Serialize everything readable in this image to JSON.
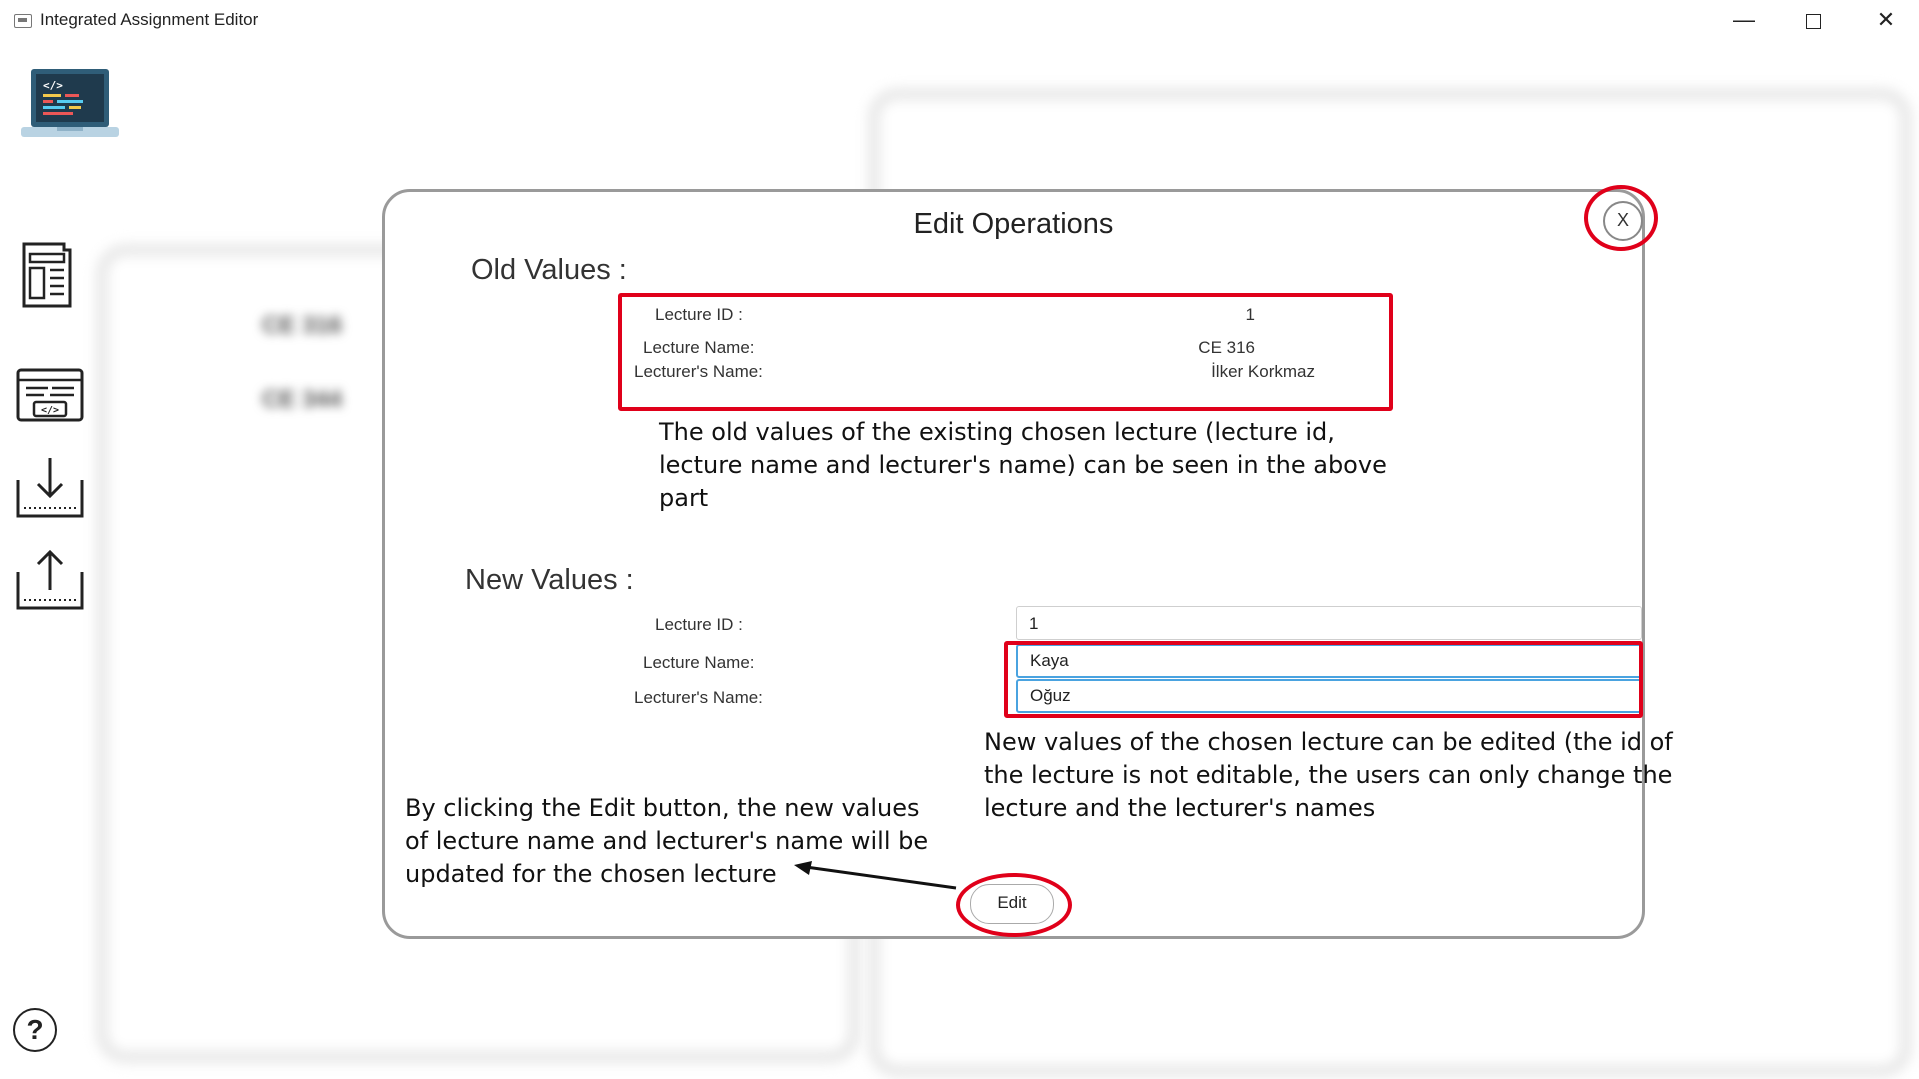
{
  "window": {
    "title": "Integrated Assignment Editor",
    "minimize_glyph": "—",
    "close_glyph": "✕"
  },
  "sidebar": {
    "icons": [
      "code-laptop-icon",
      "document-layout-icon",
      "code-window-icon",
      "download-tray-icon",
      "upload-tray-icon"
    ],
    "help_glyph": "?"
  },
  "background": {
    "left_items": [
      "CE 316",
      "CE 344"
    ]
  },
  "dialog": {
    "title": "Edit Operations",
    "close_label": "X",
    "old_values": {
      "heading": "Old Values :",
      "lecture_id_label": "Lecture ID :",
      "lecture_id_value": "1",
      "lecture_name_label": "Lecture Name:",
      "lecture_name_value": "CE 316",
      "lecturer_name_label": "Lecturer's Name:",
      "lecturer_name_value": "İlker Korkmaz"
    },
    "new_values": {
      "heading": "New Values :",
      "lecture_id_label": "Lecture ID :",
      "lecture_id_value": "1",
      "lecture_name_label": "Lecture Name:",
      "lecture_name_value": "Kaya",
      "lecturer_name_label": "Lecturer's Name:",
      "lecturer_name_value": "Oğuz"
    },
    "edit_label": "Edit"
  },
  "annotations": {
    "old_values_note": [
      "The old values of the existing chosen lecture (lecture id,",
      "lecture name and lecturer's name) can be seen in the above",
      "part"
    ],
    "new_values_note": [
      "New values of the chosen lecture can be edited (the id of",
      "the lecture is not editable, the users can only change the",
      "lecture and the lecturer's names"
    ],
    "edit_note": [
      "By clicking the Edit button, the new values",
      "of lecture name and lecturer's name will be",
      "updated for the chosen lecture"
    ],
    "highlight_color": "#e0001a"
  }
}
